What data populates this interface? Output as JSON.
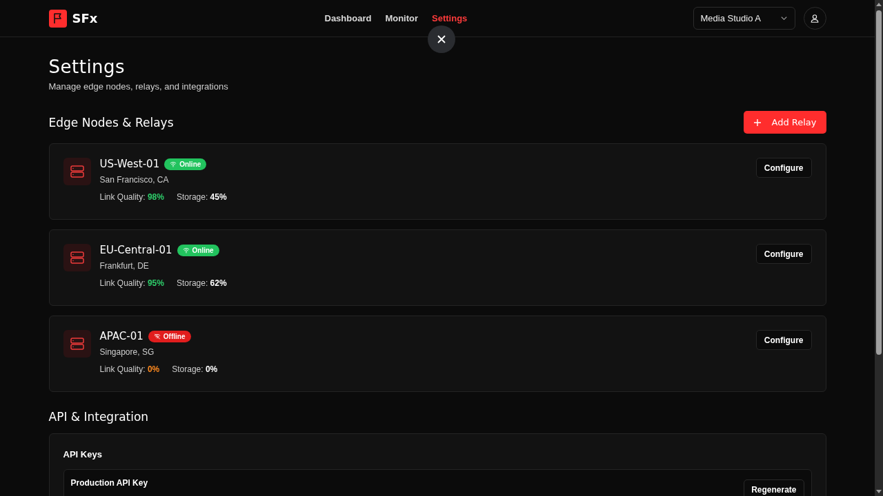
{
  "brand": {
    "name": "SFx"
  },
  "nav": [
    {
      "label": "Dashboard",
      "selected": false
    },
    {
      "label": "Monitor",
      "selected": false
    },
    {
      "label": "Settings",
      "selected": true
    }
  ],
  "workspace_select": {
    "value": "Media Studio A"
  },
  "page": {
    "title": "Settings",
    "subtitle": "Manage edge nodes, relays, and integrations"
  },
  "edge_nodes": {
    "title": "Edge Nodes & Relays",
    "add_button": "Add Relay",
    "nodes": [
      {
        "name": "US-West-01",
        "kind": "online",
        "status_label": "Online",
        "location": "San Francisco, CA",
        "link_label": "Link Quality:",
        "link_value": "98%",
        "storage_label": "Storage:",
        "storage_value": "45%",
        "button": "Configure"
      },
      {
        "name": "EU-Central-01",
        "kind": "online",
        "status_label": "Online",
        "location": "Frankfurt, DE",
        "link_label": "Link Quality:",
        "link_value": "95%",
        "storage_label": "Storage:",
        "storage_value": "62%",
        "button": "Configure"
      },
      {
        "name": "APAC-01",
        "kind": "offline",
        "status_label": "Offline",
        "location": "Singapore, SG",
        "link_label": "Link Quality:",
        "link_value": "0%",
        "storage_label": "Storage:",
        "storage_value": "0%",
        "button": "Configure"
      }
    ]
  },
  "api": {
    "title": "API & Integration",
    "card_title": "API Keys",
    "keys": [
      {
        "name": "Production API Key",
        "button": "Regenerate"
      }
    ]
  }
}
